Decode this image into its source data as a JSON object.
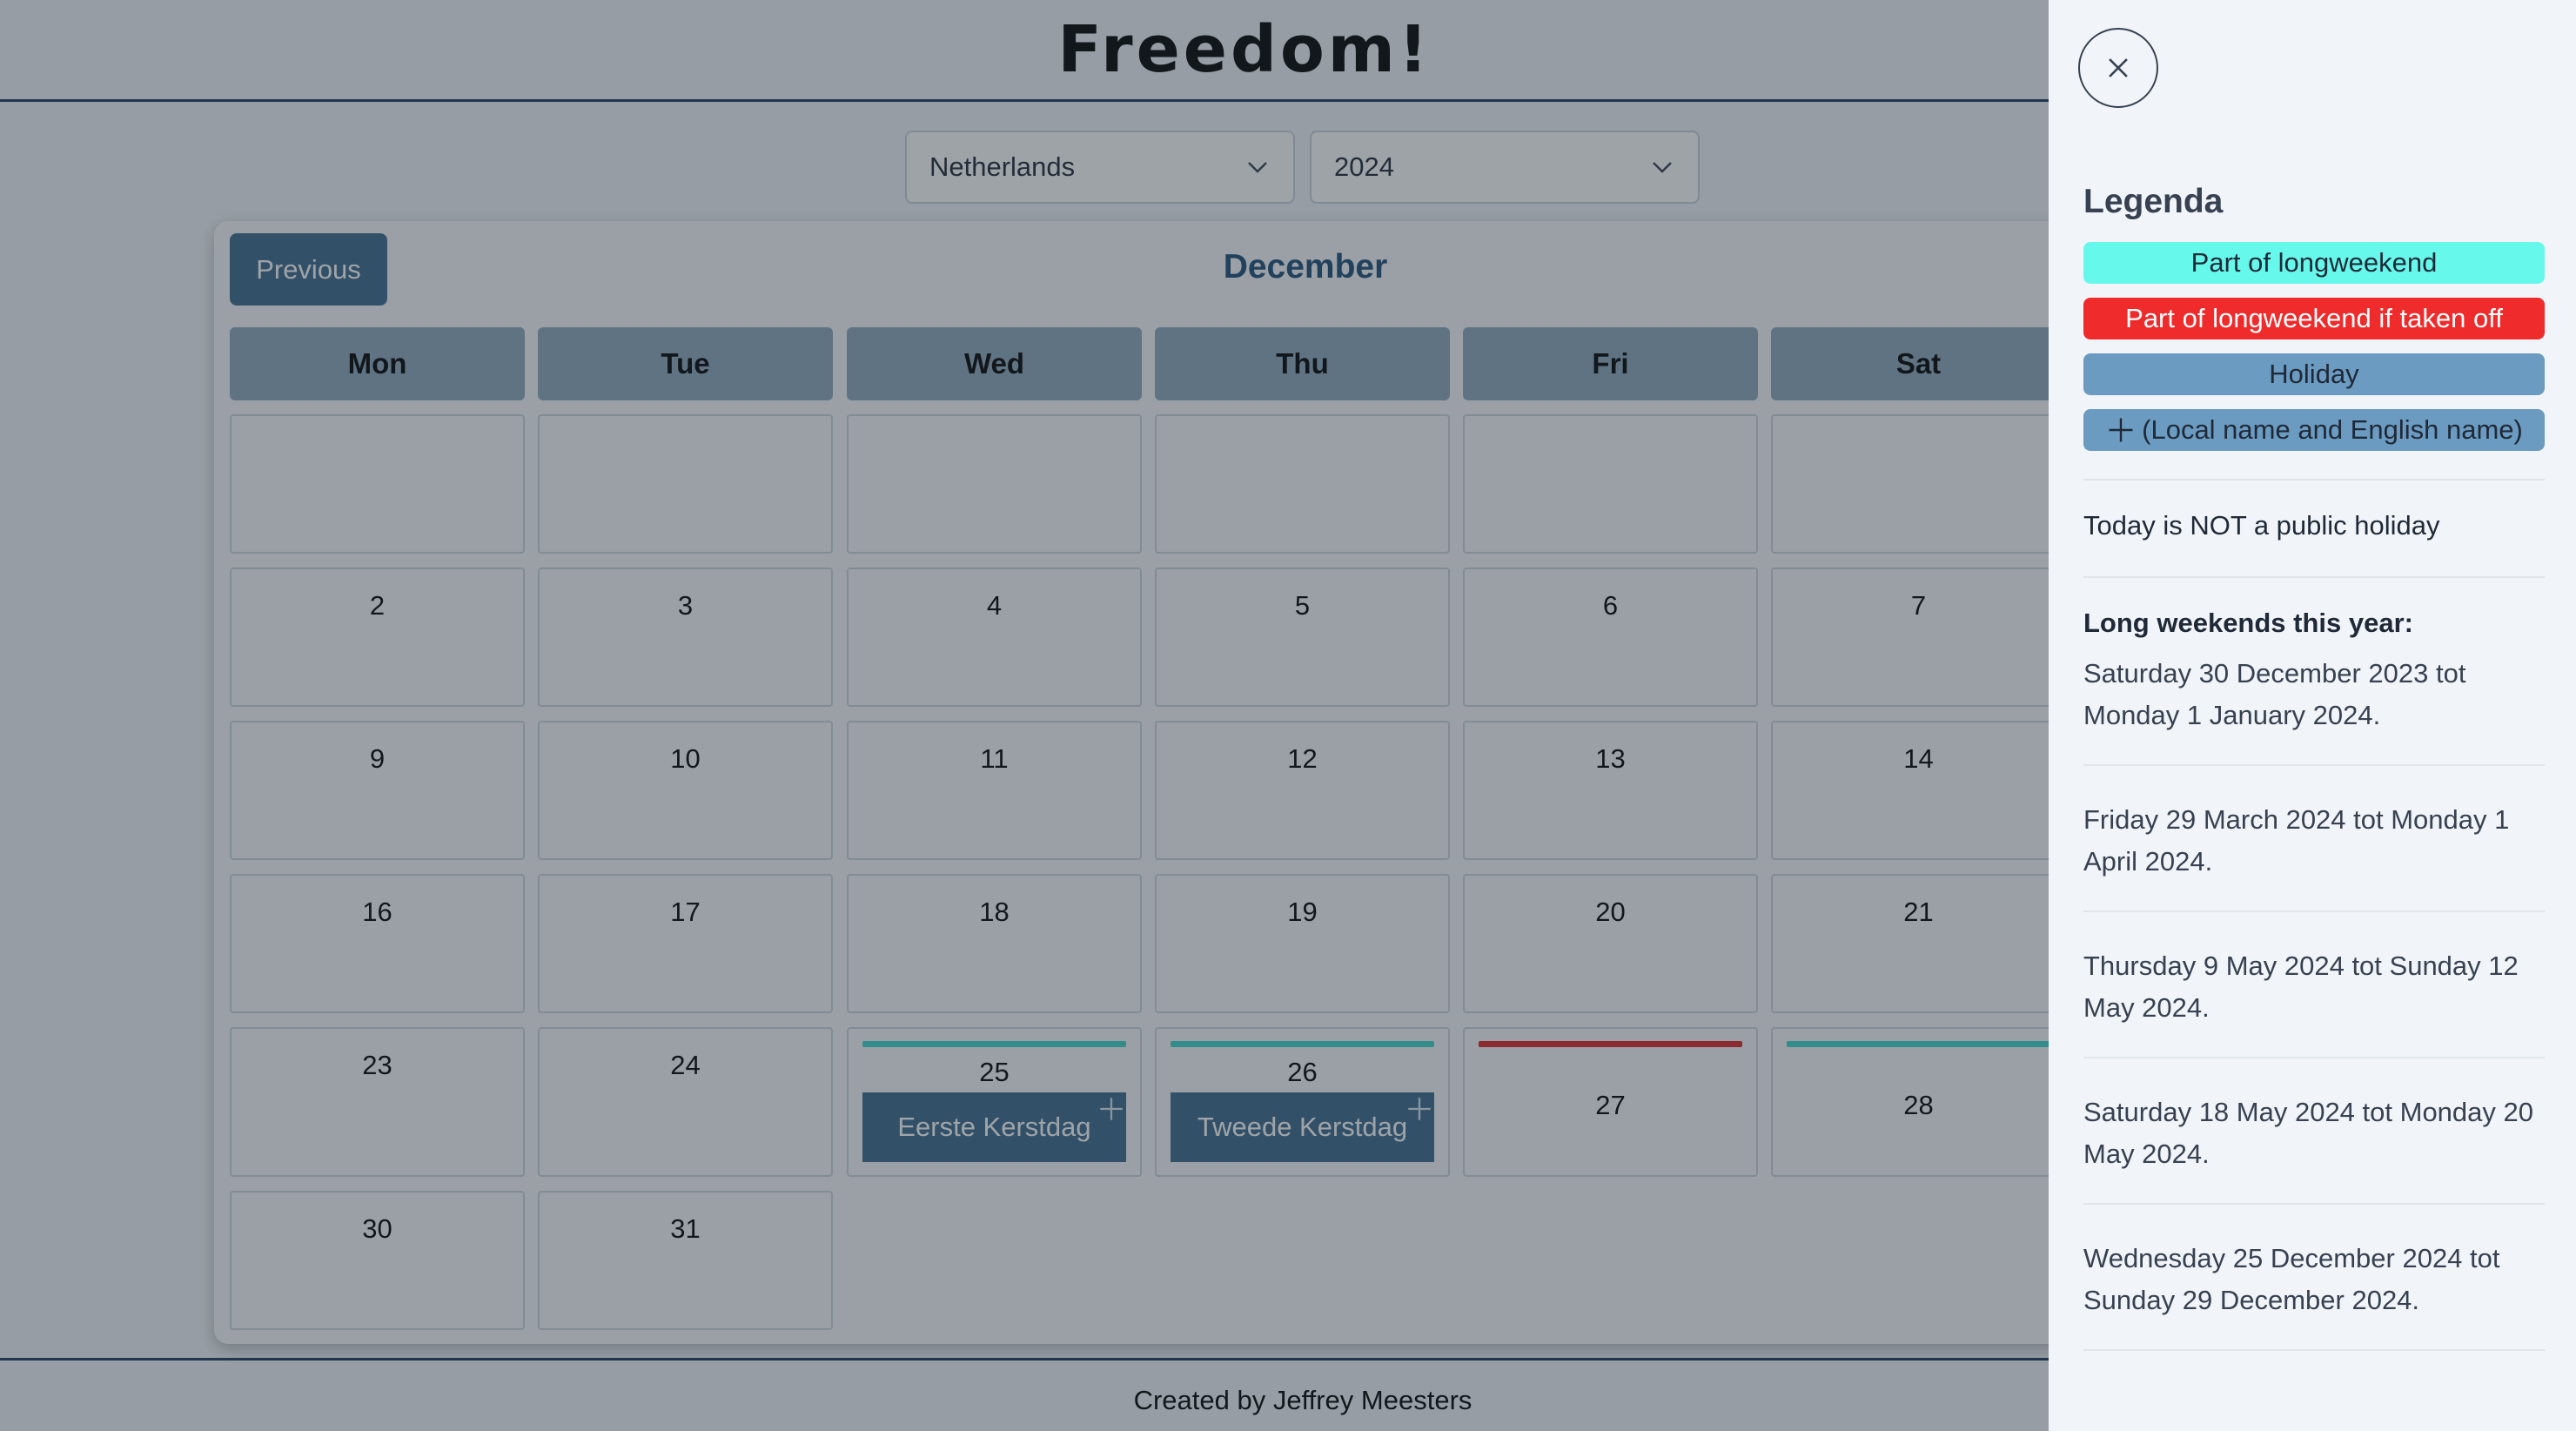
{
  "header": {
    "title": "Freedom!"
  },
  "selects": {
    "country": "Netherlands",
    "year": "2024"
  },
  "calendar": {
    "prev_label": "Previous",
    "month": "December",
    "weekdays": [
      "Mon",
      "Tue",
      "Wed",
      "Thu",
      "Fri",
      "Sat"
    ],
    "rows": [
      [
        "",
        "",
        "",
        "",
        "",
        ""
      ],
      [
        "2",
        "3",
        "4",
        "5",
        "6",
        "7"
      ],
      [
        "9",
        "10",
        "11",
        "12",
        "13",
        "14"
      ],
      [
        "16",
        "17",
        "18",
        "19",
        "20",
        "21"
      ],
      [
        "23",
        "24",
        "25",
        "26",
        "27",
        "28"
      ],
      [
        "30",
        "31"
      ]
    ],
    "holidays": {
      "d25": "Eerste Kerstdag",
      "d26": "Tweede Kerstdag"
    },
    "colors": {
      "longweekend": "#3bd6c8",
      "taken_off": "#dc2626",
      "holiday": "#3b6a8f"
    }
  },
  "footer": {
    "text": "Created by Jeffrey Meesters"
  },
  "panel": {
    "legend_title": "Legenda",
    "legend": {
      "longweekend": "Part of longweekend",
      "taken_off": "Part of longweekend if taken off",
      "holiday": "Holiday",
      "names": "(Local name and English name)"
    },
    "today": "Today is NOT a public holiday",
    "long_weekends_title": "Long weekends this year:",
    "long_weekends": [
      "Saturday 30 December 2023 tot Monday 1 January 2024.",
      "Friday 29 March 2024 tot Monday 1 April 2024.",
      "Thursday 9 May 2024 tot Sunday 12 May 2024.",
      "Saturday 18 May 2024 tot Monday 20 May 2024.",
      "Wednesday 25 December 2024 tot Sunday 29 December 2024."
    ]
  }
}
